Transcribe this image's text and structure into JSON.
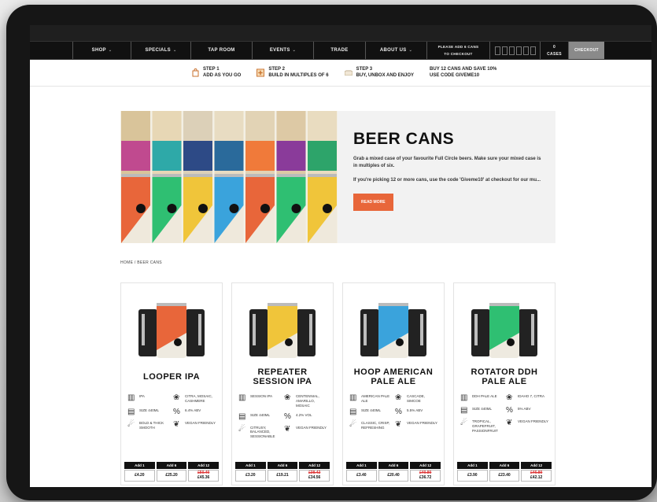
{
  "nav": {
    "items": [
      {
        "label": "Shop",
        "caret": true
      },
      {
        "label": "Specials",
        "caret": true
      },
      {
        "label": "Tap Room",
        "caret": false
      },
      {
        "label": "Events",
        "caret": true
      },
      {
        "label": "Trade",
        "caret": false
      },
      {
        "label": "About Us",
        "caret": true
      }
    ],
    "promo_line1": "Please add 6 cans",
    "promo_line2": "to checkout",
    "cases_count": "0",
    "cases_label": "Cases",
    "checkout_label": "Checkout"
  },
  "steps": [
    {
      "title": "Step 1",
      "text": "Add as you go",
      "icon": "bag-icon"
    },
    {
      "title": "Step 2",
      "text": "Build in multiples of 6",
      "icon": "plus-icon"
    },
    {
      "title": "Step 3",
      "text": "Buy, unbox and enjoy",
      "icon": "box-icon"
    },
    {
      "title": "Buy 12 cans and save 10%",
      "text": "Use code Giveme10",
      "icon": ""
    }
  ],
  "hero": {
    "title": "BEER CANS",
    "p1": "Grab a mixed case of your favourite Full Circle beers. Make sure your mixed case is in multiples of six.",
    "p2": "If you're picking 12 or more cans, use the code 'Giveme10' at checkout for our mu...",
    "read_more": "Read More",
    "accent": "#e8663a"
  },
  "breadcrumb": "Home / Beer Cans",
  "buy_headers": [
    "Add 1",
    "Add 6",
    "Add 12"
  ],
  "products": [
    {
      "name": "LOOPER IPA",
      "color": "#e8663a",
      "style": "IPA",
      "hops": "Citra, Mosaic, Cashmere",
      "size": "Size 440ml",
      "abv": "6.4% ABV",
      "taste": "Bold & Thick Smooth",
      "vegan": "Vegan Friendly",
      "price1": "£4.20",
      "price6": "£25.20",
      "price12_old": "£50.40",
      "price12": "£45.36"
    },
    {
      "name": "REPEATER SESSION IPA",
      "color": "#f0c53a",
      "style": "Session IPA",
      "hops": "Centennial, Amarillo, Mosaic",
      "size": "Size 440ml",
      "abv": "4.2% Vol",
      "taste": "Citrusy, Balanced, Sessionable",
      "vegan": "Vegan Friendly",
      "price1": "£3.20",
      "price6": "£19.21",
      "price12_old": "£38.42",
      "price12": "£34.56"
    },
    {
      "name": "HOOP AMERICAN PALE ALE",
      "color": "#3aa3dc",
      "style": "American Pale Ale",
      "hops": "Cascade, Simcoe",
      "size": "Size 440ml",
      "abv": "5.5% ABV",
      "taste": "Classic, Crisp, Refreshing",
      "vegan": "Vegan Friendly",
      "price1": "£3.40",
      "price6": "£20.40",
      "price12_old": "£40.80",
      "price12": "£36.72"
    },
    {
      "name": "ROTATOR DDH PALE ALE",
      "color": "#2fbf72",
      "style": "DDH Pale Ale",
      "hops": "Idaho 7, Citra",
      "size": "Size 440ml",
      "abv": "5% ABV",
      "taste": "Tropical, Grapefruit, Passionfruit",
      "vegan": "Vegan Friendly",
      "price1": "£3.90",
      "price6": "£23.40",
      "price12_old": "£46.80",
      "price12": "£42.12"
    }
  ]
}
